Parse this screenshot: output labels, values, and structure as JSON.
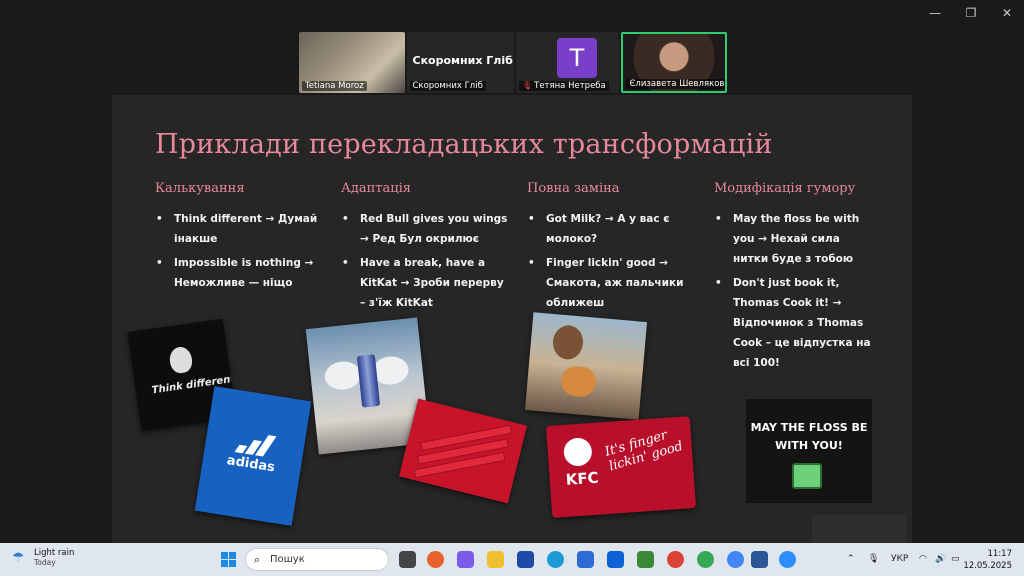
{
  "window": {
    "minimize_icon": "minimize-icon",
    "restore_icon": "restore-icon",
    "close_icon": "close-icon"
  },
  "participants": [
    {
      "name": "Tetiana Moroz"
    },
    {
      "name": "Скоромних Гліб",
      "display_title": "Скоромних Гліб"
    },
    {
      "name": "Тетяна Нетреба",
      "avatar_letter": "T",
      "muted": true
    },
    {
      "name": "Єлизавета Шевлякова",
      "active_speaker": true
    }
  ],
  "slide": {
    "title": "Приклади перекладацьких трансформацій",
    "columns": [
      {
        "heading": "Калькування",
        "items": [
          "Think different → Думай інакше",
          "Impossible is nothing → Неможливе — ніщо"
        ]
      },
      {
        "heading": "Адаптація",
        "items": [
          "Red Bull gives you wings → Ред Бул окрилює",
          "Have a break, have a KitKat → Зроби перерву – з'їж KitKat"
        ]
      },
      {
        "heading": "Повна заміна",
        "items": [
          "Got Milk? → А у вас є молоко?",
          "Finger lickin' good → Смакота, аж пальчики оближеш"
        ]
      },
      {
        "heading": "Модифікація гумору",
        "items": [
          "May the floss be with you → Нехай сила нитки буде з тобою",
          "Don't just book it, Thomas Cook it! → Відпочинок з Thomas Cook – це відпустка на всі 100!"
        ]
      }
    ],
    "images": {
      "apple_text": "Think different",
      "adidas_text": "adidas",
      "kfc_logo": "KFC",
      "kfc_slogan": "It's finger lickin' good",
      "floss_text": "MAY THE FLOSS BE WITH YOU!"
    }
  },
  "taskbar": {
    "weather": {
      "condition": "Light rain",
      "day": "Today"
    },
    "search_placeholder": "Пошук",
    "language": "УКР",
    "time": "11:17",
    "date": "12.05.2025"
  }
}
